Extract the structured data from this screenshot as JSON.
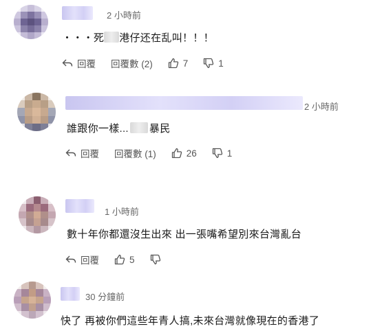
{
  "comments": [
    {
      "time": "2 小時前",
      "text_prefix": "・・・死",
      "text_suffix": "港仔还在乱叫！！！",
      "reply_label": "回覆",
      "replies_label": "回覆數 (2)",
      "likes": "7",
      "dislikes": "1"
    },
    {
      "time": "2 小時前",
      "text_prefix": "誰跟你一樣...",
      "text_suffix": "暴民",
      "reply_label": "回覆",
      "replies_label": "回覆數 (1)",
      "likes": "26",
      "dislikes": "1"
    },
    {
      "time": "1 小時前",
      "text": "數十年你都還沒生出來 出一張嘴希望別來台灣亂台",
      "reply_label": "回覆",
      "likes": "5"
    },
    {
      "time": "30 分鐘前",
      "text": "快了 再被你們這些年青人搞,未來台灣就像現在的香港了"
    }
  ],
  "icons": {
    "reply": "reply-arrow-icon",
    "like": "thumbs-up-icon",
    "dislike": "thumbs-down-icon"
  },
  "colors": {
    "text": "#1a1a1a",
    "meta": "#666666",
    "action": "#555555",
    "name_blur": "#d3d0f5"
  }
}
